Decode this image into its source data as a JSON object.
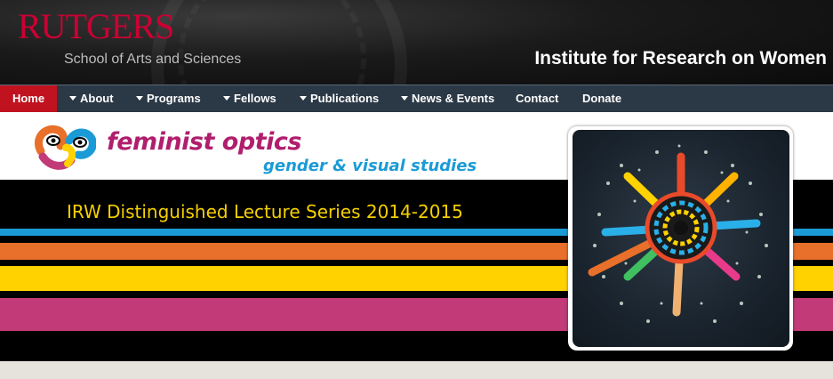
{
  "header": {
    "brand": "RUTGERS",
    "brand_sub": "School of Arts and Sciences",
    "institute": "Institute for Research on Women"
  },
  "nav": {
    "items": [
      {
        "label": "Home",
        "has_caret": false,
        "active": true
      },
      {
        "label": "About",
        "has_caret": true
      },
      {
        "label": "Programs",
        "has_caret": true
      },
      {
        "label": "Fellows",
        "has_caret": true
      },
      {
        "label": "Publications",
        "has_caret": true
      },
      {
        "label": "News & Events",
        "has_caret": true
      },
      {
        "label": "Contact",
        "has_caret": false
      },
      {
        "label": "Donate",
        "has_caret": false
      }
    ]
  },
  "banner": {
    "title": "feminist optics",
    "subtitle": "gender & visual studies",
    "series": "IRW Distinguished Lecture Series 2014-2015",
    "stripe_colors": [
      "#1b9bd6",
      "#e8702a",
      "#ffd200",
      "#c23a78"
    ],
    "image_icon": "kaleidoscope-doll-artwork"
  },
  "colors": {
    "brand_red": "#cc0033",
    "nav_bg": "#2b3845",
    "nav_active": "#c0121f",
    "title_magenta": "#b01e6d",
    "subtitle_blue": "#1b9bd6",
    "series_yellow": "#f5d000"
  }
}
